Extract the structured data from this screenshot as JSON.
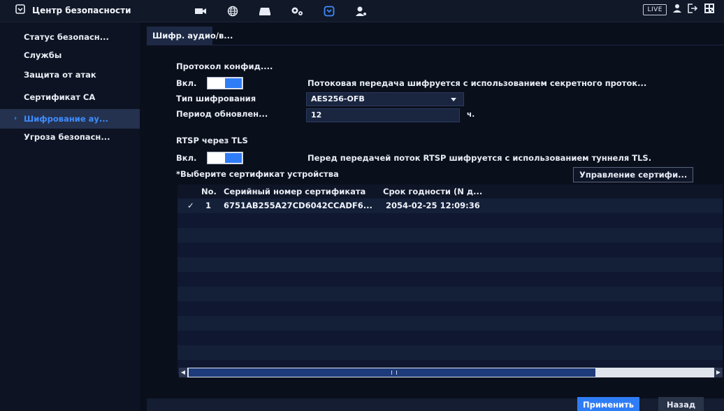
{
  "header": {
    "title": "Центр безопасности",
    "live_label": "LIVE",
    "icons": [
      "shield-icon",
      "camera-icon",
      "network-icon",
      "storage-icon",
      "settings-icon",
      "security-icon",
      "account-icon",
      "user-icon",
      "logout-icon",
      "qr-icon"
    ],
    "active_nav": "security-icon"
  },
  "sidebar": {
    "items": [
      {
        "label": "Статус безопасн..."
      },
      {
        "label": "Службы"
      },
      {
        "label": "Защита от атак"
      },
      {
        "label": "Сертификат CA"
      },
      {
        "label": "Шифрование ау..."
      },
      {
        "label": "Угроза безопасн..."
      }
    ],
    "active_index": 4
  },
  "tabs": {
    "active_label": "Шифр. аудио/в..."
  },
  "protocol": {
    "section_title": "Протокол конфид....",
    "enable_label": "Вкл.",
    "enabled": true,
    "enable_desc": "Потоковая передача шифруется с использованием секретного проток...",
    "cipher_label": "Тип шифрования",
    "cipher_value": "AES256-OFB",
    "period_label": "Период обновлен...",
    "period_value": "12",
    "period_unit": "ч."
  },
  "rtsp": {
    "section_title": "RTSP через TLS",
    "enable_label": "Вкл.",
    "enabled": true,
    "enable_desc": "Перед передачей поток RTSP шифруется с использованием туннеля TLS.",
    "cert_select_label": "*Выберите сертификат устройства",
    "manage_button": "Управление сертифи..."
  },
  "table": {
    "columns": [
      "No.",
      "Серийный номер сертификата",
      "Срок годности (N д..."
    ],
    "rows": [
      {
        "checked": true,
        "no": "1",
        "serial": "6751AB255A27CD6042CCADF6...",
        "expiry": "2054-02-25 12:09:36"
      }
    ]
  },
  "footer": {
    "apply_label": "Применить",
    "back_label": "Назад"
  },
  "colors": {
    "accent": "#2f7df6",
    "active_text": "#3f8cff",
    "background": "#0a0f1c"
  }
}
